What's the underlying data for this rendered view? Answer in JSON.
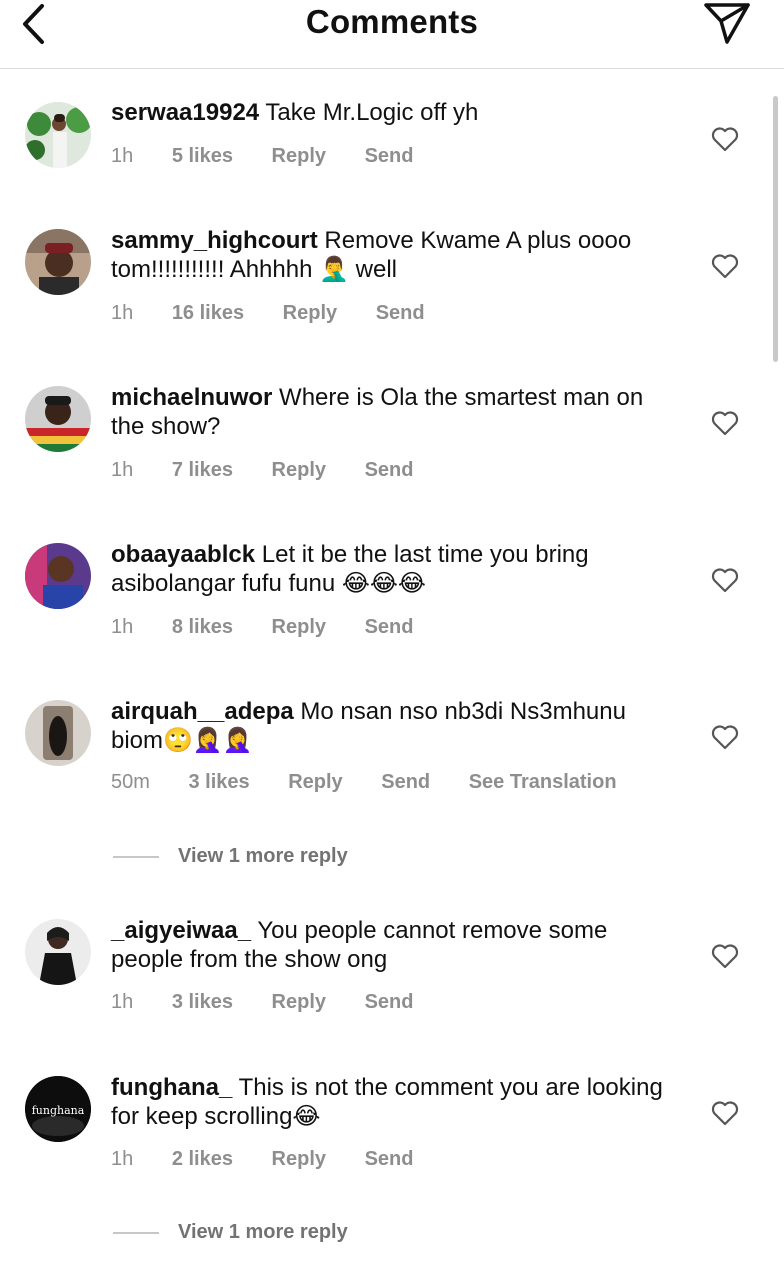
{
  "header": {
    "title": "Comments",
    "back_icon": "chevron-left-icon",
    "share_icon": "paper-plane-icon"
  },
  "comments": [
    {
      "username": "serwaa19924",
      "text": "Take Mr.Logic off yh",
      "time": "1h",
      "likes": "5 likes",
      "reply": "Reply",
      "send": "Send"
    },
    {
      "username": "sammy_highcourt",
      "text": "Remove Kwame A plus oooo tom!!!!!!!!!!! Ahhhhh 🤦‍♂️ well",
      "time": "1h",
      "likes": "16 likes",
      "reply": "Reply",
      "send": "Send"
    },
    {
      "username": "michaelnuwor",
      "text": "Where is Ola the smartest man on the show?",
      "time": "1h",
      "likes": "7 likes",
      "reply": "Reply",
      "send": "Send"
    },
    {
      "username": "obaayaablck",
      "text": "Let it be the last time you bring asibolangar fufu funu 😂😂😂",
      "time": "1h",
      "likes": "8 likes",
      "reply": "Reply",
      "send": "Send"
    },
    {
      "username": "airquah__adepa",
      "text": "Mo nsan nso nb3di Ns3mhunu biom🙄🤦‍♀️🤦‍♀️",
      "time": "50m",
      "likes": "3 likes",
      "reply": "Reply",
      "send": "Send",
      "translate": "See Translation",
      "more_replies": "View 1 more reply"
    },
    {
      "username": "_aigyeiwaa_",
      "text": "You people cannot remove some people from the show ong",
      "time": "1h",
      "likes": "3 likes",
      "reply": "Reply",
      "send": "Send"
    },
    {
      "username": "funghana_",
      "avatar_text": "funghana",
      "text": "This is not the comment you are looking for keep scrolling😂",
      "time": "1h",
      "likes": "2 likes",
      "reply": "Reply",
      "send": "Send",
      "more_replies": "View 1 more reply"
    }
  ],
  "colors": {
    "text": "#111111",
    "meta": "#8e8e8e",
    "divider": "#dcdcdc"
  }
}
